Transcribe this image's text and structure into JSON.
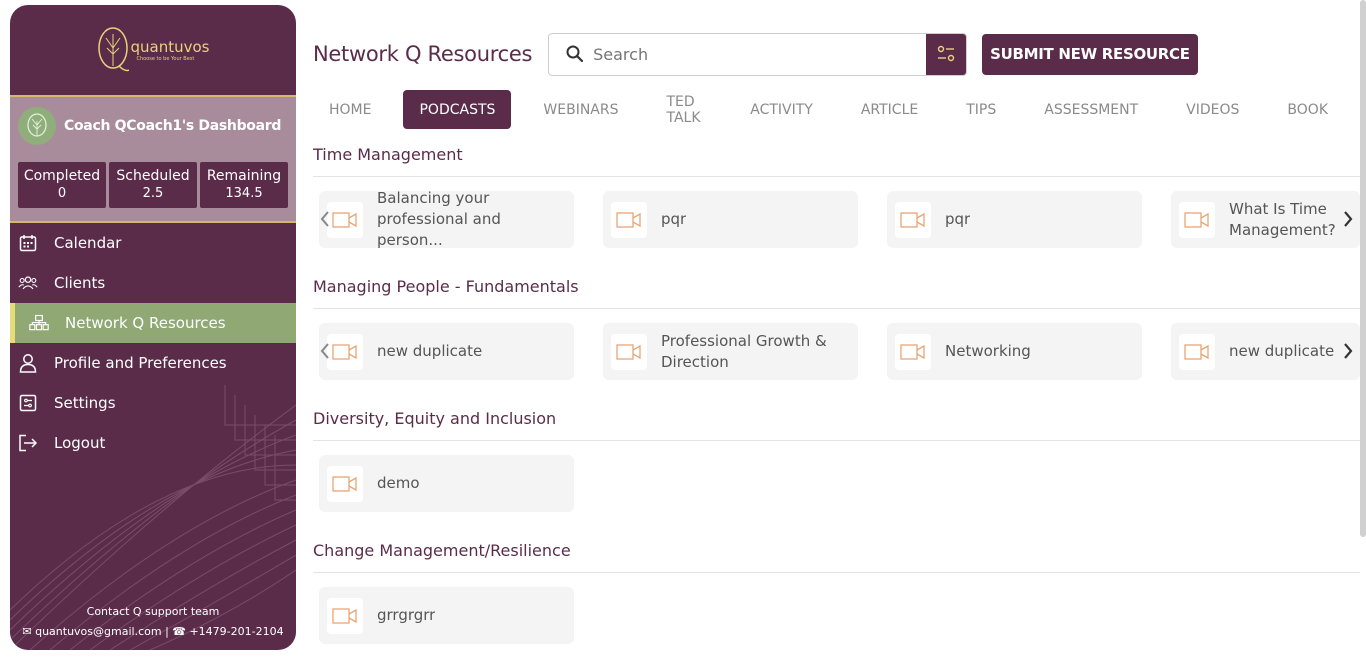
{
  "brand": {
    "name": "quantuvos",
    "tagline": "Choose to be Your Best",
    "logo_color": "#e8d27a"
  },
  "dashboard": {
    "title": "Coach QCoach1's Dashboard",
    "stats": [
      {
        "label": "Completed",
        "value": "0"
      },
      {
        "label": "Scheduled",
        "value": "2.5"
      },
      {
        "label": "Remaining",
        "value": "134.5"
      }
    ]
  },
  "nav": [
    {
      "label": "Calendar",
      "icon": "calendar-icon"
    },
    {
      "label": "Clients",
      "icon": "users-icon"
    },
    {
      "label": "Network Q Resources",
      "icon": "network-icon",
      "active": true
    },
    {
      "label": "Profile and Preferences",
      "icon": "user-icon"
    },
    {
      "label": "Settings",
      "icon": "settings-icon"
    },
    {
      "label": "Logout",
      "icon": "logout-icon"
    }
  ],
  "contact": {
    "title": "Contact Q support team",
    "email": "quantuvos@gmail.com",
    "phone": "+1479-201-2104"
  },
  "header": {
    "title": "Network Q Resources",
    "search_placeholder": "Search",
    "submit_label": "SUBMIT NEW RESOURCE"
  },
  "tabs": [
    "HOME",
    "PODCASTS",
    "WEBINARS",
    "TED TALK",
    "ACTIVITY",
    "ARTICLE",
    "TIPS",
    "ASSESSMENT",
    "VIDEOS",
    "BOOK"
  ],
  "active_tab": "PODCASTS",
  "sections": [
    {
      "title": "Time Management",
      "cards": [
        "Balancing your professional and person...",
        "pqr",
        "pqr",
        "What Is Time Management?"
      ]
    },
    {
      "title": "Managing People - Fundamentals",
      "cards": [
        "new duplicate",
        "Professional Growth & Direction",
        "Networking",
        "new duplicate"
      ]
    },
    {
      "title": "Diversity, Equity and Inclusion",
      "cards": [
        "demo"
      ]
    },
    {
      "title": "Change Management/Resilience",
      "cards": [
        "grrgrgrr"
      ]
    }
  ],
  "colors": {
    "primary": "#5a2c4a",
    "accent_green": "#8fa874",
    "accent_gold": "#d7b86a",
    "video_icon": "#e8a574"
  }
}
